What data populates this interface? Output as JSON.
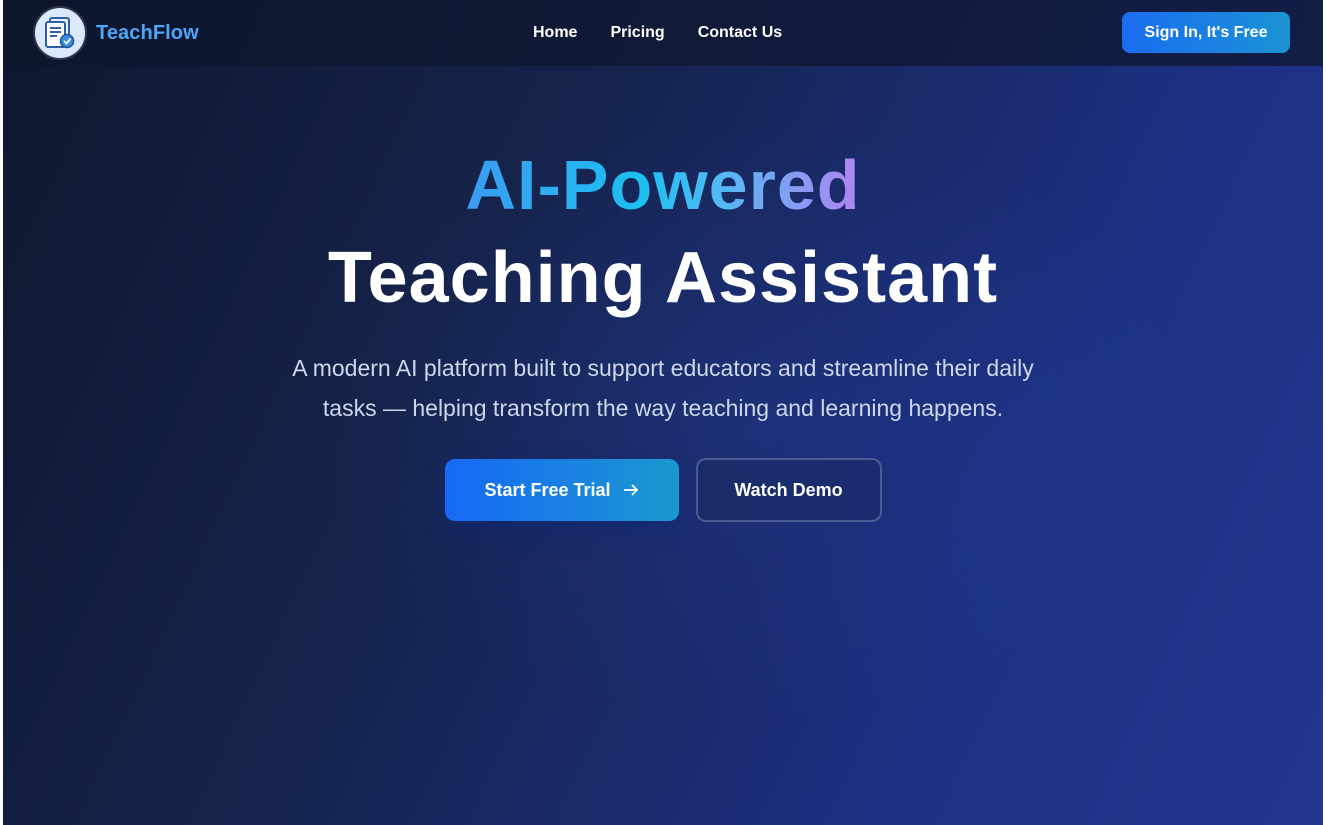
{
  "nav": {
    "brand_name": "TeachFlow",
    "logo_icon": "document-certificate-icon",
    "links": [
      {
        "label": "Home"
      },
      {
        "label": "Pricing"
      },
      {
        "label": "Contact Us"
      }
    ],
    "signin_label": "Sign In, It's Free"
  },
  "hero": {
    "headline_gradient": "AI-Powered",
    "headline_main": "Teaching Assistant",
    "subtitle": "A modern AI platform built to support educators and streamline their daily tasks — helping transform the way teaching and learning happens.",
    "primary_cta": "Start Free Trial",
    "primary_cta_icon": "arrow-right-icon",
    "secondary_cta": "Watch Demo"
  },
  "colors": {
    "background_dark": "#0f172e",
    "background_light": "#233690",
    "brand_text": "#4fa6f5",
    "primary_button_start": "#1669f5",
    "primary_button_end": "#1b98cf",
    "headline_gradient_start": "#3b9bf2",
    "headline_gradient_end": "#b283f2"
  }
}
